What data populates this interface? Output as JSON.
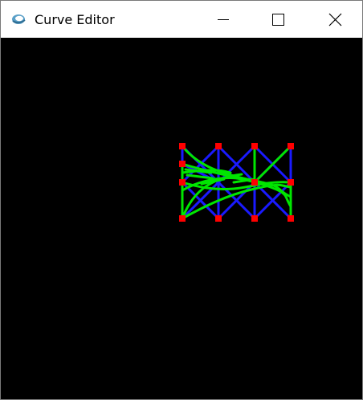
{
  "window": {
    "title": "Curve Editor",
    "controls": {
      "minimize": "minimize-icon",
      "maximize": "maximize-icon",
      "close": "close-icon"
    }
  },
  "canvas": {
    "background": "#000000",
    "colors": {
      "control_polygon": "#1a1aff",
      "curve": "#00e600",
      "control_point": "#ff0000"
    }
  }
}
